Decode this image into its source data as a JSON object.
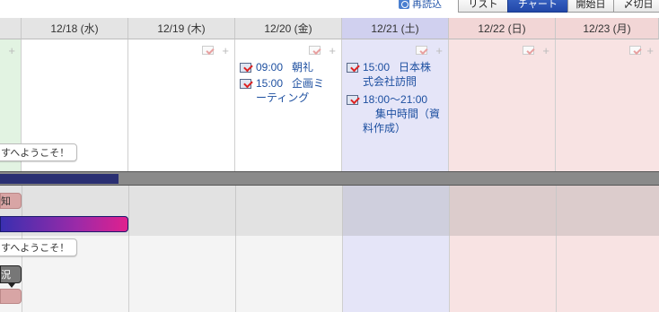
{
  "toolbar": {
    "reload_label": "再読込",
    "buttons": [
      {
        "label": "リスト",
        "active": false
      },
      {
        "label": "チャート",
        "active": true
      },
      {
        "label": "開始日",
        "active": false
      },
      {
        "label": "〆切日",
        "active": false
      }
    ]
  },
  "days": [
    {
      "label": "",
      "bg": "#e2f3e2",
      "head_bg": "#e4e4e4"
    },
    {
      "label": "12/18 (水)",
      "bg": "#ffffff",
      "head_bg": "#e4e4e4"
    },
    {
      "label": "12/19 (木)",
      "bg": "#ffffff",
      "head_bg": "#e4e4e4"
    },
    {
      "label": "12/20 (金)",
      "bg": "#ffffff",
      "head_bg": "#e4e4e4"
    },
    {
      "label": "12/21 (土)",
      "bg": "#e5e5f8",
      "head_bg": "#d0d0ef"
    },
    {
      "label": "12/22 (日)",
      "bg": "#f8e3e3",
      "head_bg": "#f2d6d6"
    },
    {
      "label": "12/23 (月)",
      "bg": "#f8e3e3",
      "head_bg": "#f2d6d6"
    }
  ],
  "events": {
    "fri_1": {
      "time": "09:00",
      "title": "朝礼"
    },
    "fri_2": {
      "time": "15:00",
      "title": "企画ミ",
      "title_cont": "ーティング"
    },
    "sat_1": {
      "time": "15:00",
      "title": "日本株",
      "title_cont": "式会社訪問"
    },
    "sat_2": {
      "time": "18:00〜21:00",
      "title": "集中時間（資",
      "title_cont": "料作成）"
    }
  },
  "welcome_1": "すへようこそ！",
  "welcome_2": "すへようこそ！",
  "gantt": {
    "tag_1": "知",
    "dark_tag": "況",
    "progress": 0.18,
    "colors": {
      "bar": "#2a2f72",
      "track": "#8a8a8a"
    }
  }
}
